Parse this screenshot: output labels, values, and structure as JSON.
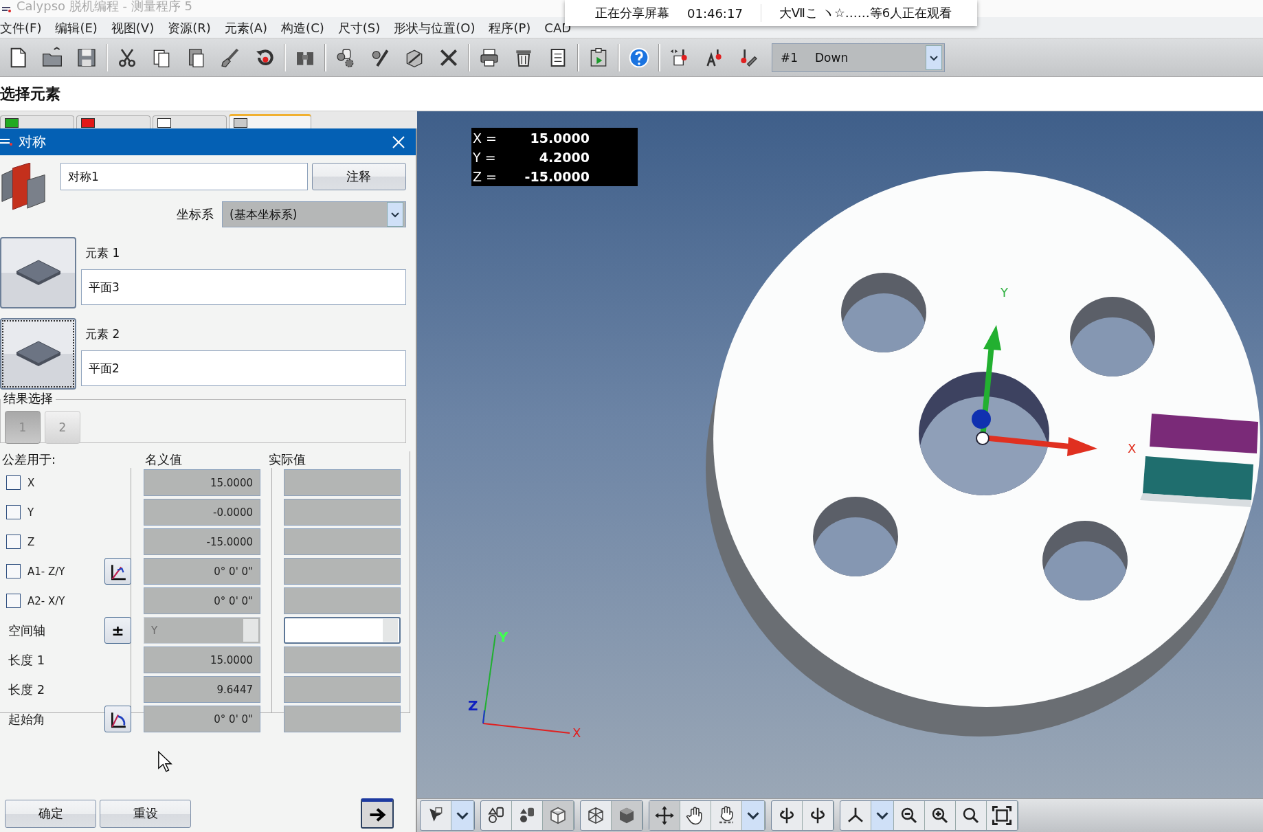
{
  "window": {
    "title": "Calypso 脱机编程 - 测量程序 5"
  },
  "share_bar": {
    "status": "正在分享屏幕",
    "elapsed": "01:46:17",
    "viewers": "大Ⅶこ ヽ☆……等6人正在观看"
  },
  "menu": [
    {
      "label": "文件(F)"
    },
    {
      "label": "编辑(E)"
    },
    {
      "label": "视图(V)"
    },
    {
      "label": "资源(R)"
    },
    {
      "label": "元素(A)"
    },
    {
      "label": "构造(C)"
    },
    {
      "label": "尺寸(S)"
    },
    {
      "label": "形状与位置(O)"
    },
    {
      "label": "程序(P)"
    },
    {
      "label": "CAD"
    }
  ],
  "toolbar": {
    "probe_number": "#1",
    "probe_value": "Down"
  },
  "section_label": "选择元素",
  "feature_tabs": [
    {
      "selected": false
    },
    {
      "selected": false
    },
    {
      "selected": false
    },
    {
      "selected": true
    }
  ],
  "dialog": {
    "title": "对称",
    "name": "对称1",
    "comment_button": "注释",
    "coord_label": "坐标系",
    "coord_value": "(基本坐标系)",
    "elements": [
      {
        "label": "元素 1",
        "value": "平面3",
        "focused": false
      },
      {
        "label": "元素 2",
        "value": "平面2",
        "focused": true
      }
    ],
    "result_group": "结果选择",
    "result_options": [
      {
        "label": "1",
        "selected": true
      },
      {
        "label": "2",
        "selected": false
      }
    ],
    "tolerance_header": "公差用于:",
    "nominal_header": "名义值",
    "actual_header": "实际值",
    "rows": [
      {
        "kind": "check",
        "label": "X",
        "checked": false,
        "nominal": "15.0000"
      },
      {
        "kind": "check",
        "label": "Y",
        "checked": false,
        "nominal": "-0.0000"
      },
      {
        "kind": "check",
        "label": "Z",
        "checked": false,
        "nominal": "-15.0000"
      },
      {
        "kind": "check",
        "label": "A1- Z/Y",
        "checked": false,
        "nominal": "0° 0' 0\"",
        "button": {
          "kind": "angle"
        }
      },
      {
        "kind": "check",
        "label": "A2- X/Y",
        "checked": false,
        "nominal": "0° 0' 0\""
      },
      {
        "kind": "select",
        "label": "空间轴",
        "button_text": "±",
        "nominal": "Y"
      },
      {
        "kind": "plain",
        "label": "长度 1",
        "nominal": "15.0000"
      },
      {
        "kind": "plain",
        "label": "长度 2",
        "nominal": "9.6447"
      },
      {
        "kind": "plain",
        "label": "起始角",
        "nominal": "0° 0' 0\"",
        "button": {
          "kind": "start_angle"
        }
      }
    ],
    "ok_button": "确定",
    "reset_button": "重设"
  },
  "view": {
    "coords": [
      {
        "axis": "X =",
        "value": "15.0000"
      },
      {
        "axis": "Y =",
        "value": "4.2000"
      },
      {
        "axis": "Z =",
        "value": "-15.0000"
      }
    ],
    "triad_labels": {
      "x": "X",
      "y": "Y"
    },
    "corner_axes": {
      "x": "X",
      "y": "Y",
      "z": "Z"
    }
  }
}
